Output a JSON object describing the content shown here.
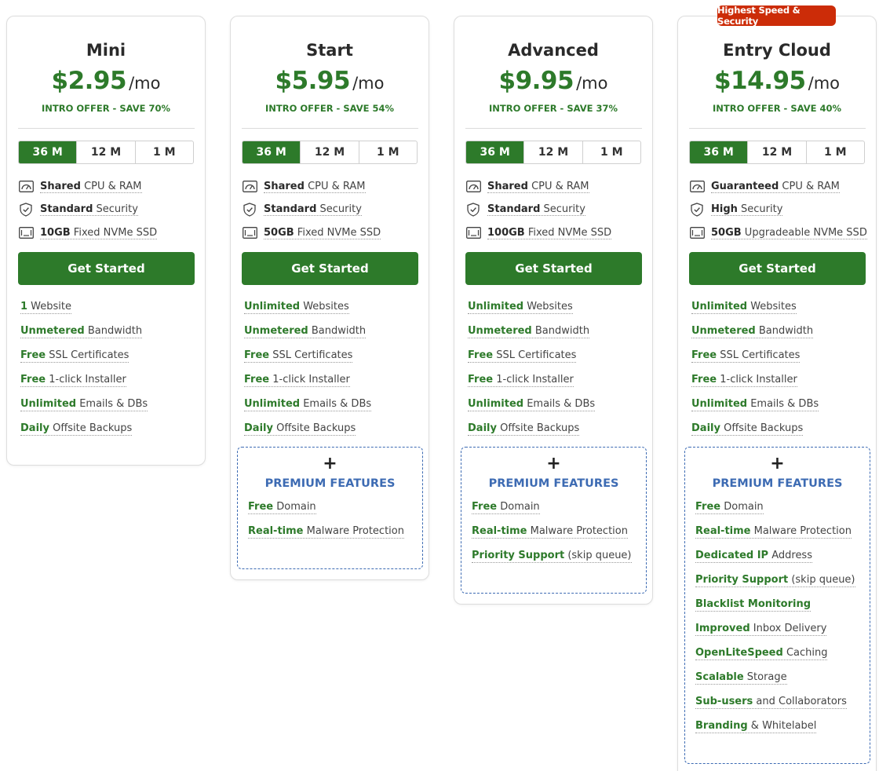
{
  "tabs": [
    "36 M",
    "12 M",
    "1 M"
  ],
  "colors": {
    "accent": "#2d7a2a",
    "badge": "#cc2c08",
    "premium": "#3d6bb3"
  },
  "icons": {
    "cpu": "speedometer-icon",
    "security": "shield-check-icon",
    "storage": "ssd-drive-icon"
  },
  "plans": [
    {
      "name": "Mini",
      "price": "$2.95",
      "per": "/mo",
      "offer": "INTRO OFFER - SAVE 70%",
      "specs": [
        {
          "b": "Shared",
          "t": " CPU & RAM"
        },
        {
          "b": "Standard",
          "t": " Security"
        },
        {
          "b": "10GB",
          "t": " Fixed NVMe SSD"
        }
      ],
      "cta": "Get Started",
      "features": [
        {
          "b": "1",
          "t": " Website"
        },
        {
          "b": "Unmetered",
          "t": " Bandwidth"
        },
        {
          "b": "Free",
          "t": " SSL Certificates"
        },
        {
          "b": "Free",
          "t": " 1-click Installer"
        },
        {
          "b": "Unlimited",
          "t": " Emails & DBs"
        },
        {
          "b": "Daily",
          "t": " Offsite Backups"
        }
      ]
    },
    {
      "name": "Start",
      "price": "$5.95",
      "per": "/mo",
      "offer": "INTRO OFFER - SAVE 54%",
      "specs": [
        {
          "b": "Shared",
          "t": " CPU & RAM"
        },
        {
          "b": "Standard",
          "t": " Security"
        },
        {
          "b": "50GB",
          "t": " Fixed NVMe SSD"
        }
      ],
      "cta": "Get Started",
      "features": [
        {
          "b": "Unlimited",
          "t": " Websites"
        },
        {
          "b": "Unmetered",
          "t": " Bandwidth"
        },
        {
          "b": "Free",
          "t": " SSL Certificates"
        },
        {
          "b": "Free",
          "t": " 1-click Installer"
        },
        {
          "b": "Unlimited",
          "t": " Emails & DBs"
        },
        {
          "b": "Daily",
          "t": " Offsite Backups"
        }
      ],
      "premium": {
        "plus": "+",
        "title": "PREMIUM FEATURES",
        "items": [
          {
            "b": "Free",
            "t": " Domain"
          },
          {
            "b": "Real-time",
            "t": " Malware Protection"
          }
        ]
      }
    },
    {
      "name": "Advanced",
      "price": "$9.95",
      "per": "/mo",
      "offer": "INTRO OFFER - SAVE 37%",
      "specs": [
        {
          "b": "Shared",
          "t": " CPU & RAM"
        },
        {
          "b": "Standard",
          "t": " Security"
        },
        {
          "b": "100GB",
          "t": " Fixed NVMe SSD"
        }
      ],
      "cta": "Get Started",
      "features": [
        {
          "b": "Unlimited",
          "t": " Websites"
        },
        {
          "b": "Unmetered",
          "t": " Bandwidth"
        },
        {
          "b": "Free",
          "t": " SSL Certificates"
        },
        {
          "b": "Free",
          "t": " 1-click Installer"
        },
        {
          "b": "Unlimited",
          "t": " Emails & DBs"
        },
        {
          "b": "Daily",
          "t": " Offsite Backups"
        }
      ],
      "premium": {
        "plus": "+",
        "title": "PREMIUM FEATURES",
        "items": [
          {
            "b": "Free",
            "t": " Domain"
          },
          {
            "b": "Real-time",
            "t": " Malware Protection"
          },
          {
            "b": "Priority Support",
            "t": " (skip queue)"
          }
        ]
      }
    },
    {
      "name": "Entry Cloud",
      "badge": "Highest Speed & Security",
      "price": "$14.95",
      "per": "/mo",
      "offer": "INTRO OFFER - SAVE 40%",
      "specs": [
        {
          "b": "Guaranteed",
          "t": " CPU & RAM"
        },
        {
          "b": "High",
          "t": " Security"
        },
        {
          "b": "50GB",
          "t": " Upgradeable NVMe SSD"
        }
      ],
      "cta": "Get Started",
      "features": [
        {
          "b": "Unlimited",
          "t": " Websites"
        },
        {
          "b": "Unmetered",
          "t": " Bandwidth"
        },
        {
          "b": "Free",
          "t": " SSL Certificates"
        },
        {
          "b": "Free",
          "t": " 1-click Installer"
        },
        {
          "b": "Unlimited",
          "t": " Emails & DBs"
        },
        {
          "b": "Daily",
          "t": " Offsite Backups"
        }
      ],
      "premium": {
        "plus": "+",
        "title": "PREMIUM FEATURES",
        "items": [
          {
            "b": "Free",
            "t": " Domain"
          },
          {
            "b": "Real-time",
            "t": " Malware Protection"
          },
          {
            "b": "Dedicated IP",
            "t": " Address"
          },
          {
            "b": "Priority Support",
            "t": " (skip queue)"
          },
          {
            "b": "Blacklist Monitoring",
            "t": ""
          },
          {
            "b": "Improved",
            "t": " Inbox Delivery"
          },
          {
            "b": "OpenLiteSpeed",
            "t": " Caching"
          },
          {
            "b": "Scalable",
            "t": " Storage"
          },
          {
            "b": "Sub-users",
            "t": " and Collaborators"
          },
          {
            "b": "Branding",
            "t": " & Whitelabel"
          }
        ]
      }
    }
  ]
}
